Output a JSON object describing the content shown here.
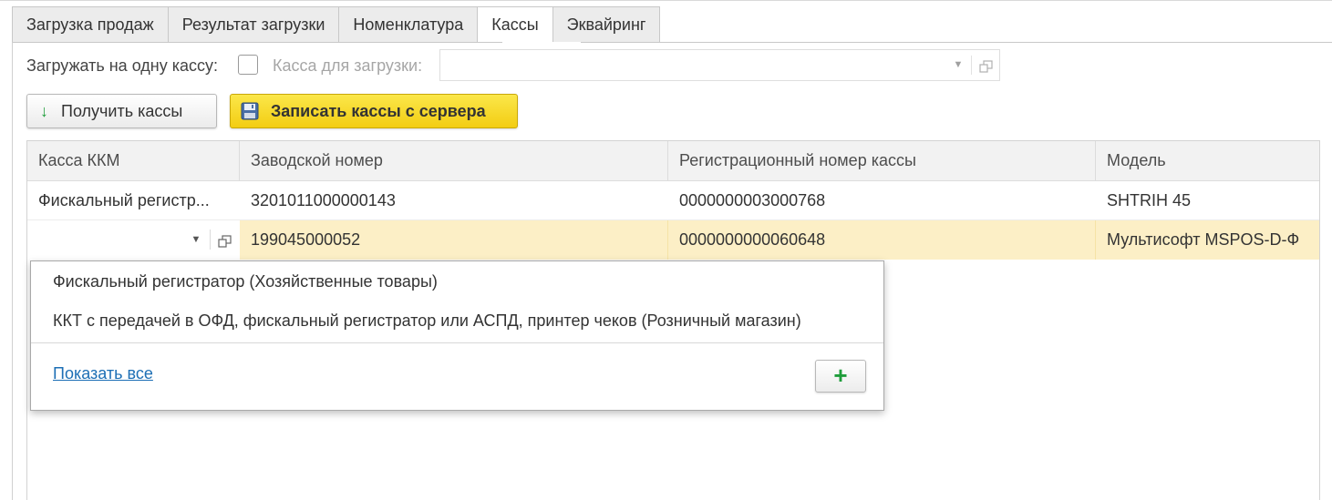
{
  "tabs": [
    {
      "label": "Загрузка продаж"
    },
    {
      "label": "Результат загрузки"
    },
    {
      "label": "Номенклатура"
    },
    {
      "label": "Кассы"
    },
    {
      "label": "Эквайринг"
    }
  ],
  "active_tab": "Кассы",
  "load_one_label": "Загружать на одну кассу:",
  "load_one_checked": false,
  "kassa_label": "Касса для загрузки:",
  "kassa_value": "",
  "buttons": {
    "get_label": "Получить кассы",
    "save_label": "Записать кассы с сервера"
  },
  "table": {
    "columns": [
      "Касса ККМ",
      "Заводской номер",
      "Регистрационный номер кассы",
      "Модель"
    ],
    "rows": [
      {
        "kassa": "Фискальный регистр...",
        "serial": "3201011000000143",
        "reg": "0000000003000768",
        "model": "SHTRIH 45"
      },
      {
        "kassa": "",
        "serial": "199045000052",
        "reg": "0000000000060648",
        "model": "Мультисофт MSPOS-D-Ф"
      }
    ]
  },
  "dropdown": {
    "items": [
      "Фискальный регистратор (Хозяйственные товары)",
      "ККТ с передачей в ОФД, фискальный регистратор или АСПД, принтер чеков (Розничный магазин)"
    ],
    "show_all": "Показать все",
    "add_symbol": "+"
  },
  "colors": {
    "accent_yellow": "#f5d21f",
    "highlight_row": "#fcefc6",
    "link": "#1d6fb5",
    "green_icon": "#1e9d3a"
  }
}
